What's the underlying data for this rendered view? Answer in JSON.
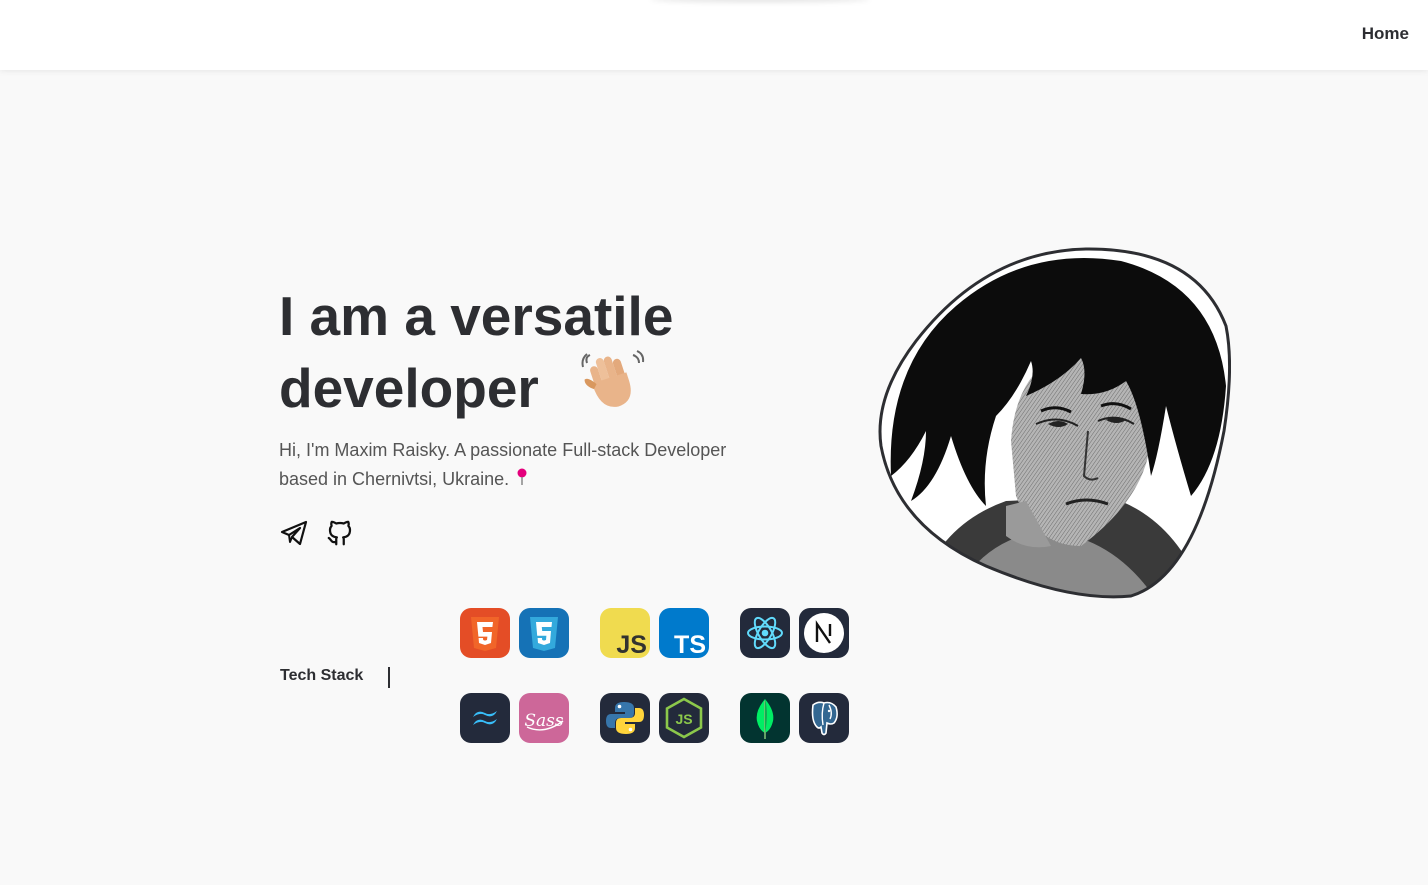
{
  "nav": {
    "home": "Home"
  },
  "hero": {
    "title_line1": "I am a versatile",
    "title_line2": "developer",
    "intro": "Hi, I'm Maxim Raisky. A passionate Full-stack Developer based in Chernivtsi, Ukraine."
  },
  "socials": [
    {
      "icon": "telegram-icon"
    },
    {
      "icon": "github-icon"
    }
  ],
  "tech_stack": {
    "label": "Tech Stack",
    "icons": [
      {
        "name": "html5",
        "text": "5"
      },
      {
        "name": "css3",
        "text": "3"
      },
      {
        "name": "javascript",
        "text": "JS"
      },
      {
        "name": "typescript",
        "text": "TS"
      },
      {
        "name": "react",
        "text": ""
      },
      {
        "name": "nextjs",
        "text": "N"
      },
      {
        "name": "tailwind",
        "text": ""
      },
      {
        "name": "sass",
        "text": "Sass"
      },
      {
        "name": "python",
        "text": ""
      },
      {
        "name": "nodejs",
        "text": "JS"
      },
      {
        "name": "mongodb",
        "text": ""
      },
      {
        "name": "postgresql",
        "text": ""
      }
    ]
  },
  "colors": {
    "text": "#2d2e32",
    "muted": "#555555",
    "background": "#f9f9f9",
    "tile_dark": "#232a3b"
  }
}
